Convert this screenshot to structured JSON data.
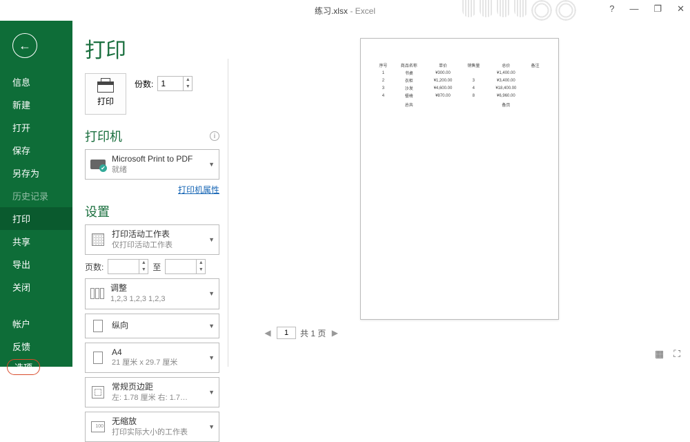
{
  "titlebar": {
    "filename": "练习.xlsx",
    "app": "Excel",
    "help": "?",
    "min": "—",
    "max": "❐",
    "close": "✕"
  },
  "sidebar": {
    "items": [
      {
        "label": "信息"
      },
      {
        "label": "新建"
      },
      {
        "label": "打开"
      },
      {
        "label": "保存"
      },
      {
        "label": "另存为"
      },
      {
        "label": "历史记录",
        "dim": true
      },
      {
        "label": "打印",
        "active": true
      },
      {
        "label": "共享"
      },
      {
        "label": "导出"
      },
      {
        "label": "关闭"
      }
    ],
    "bottom": [
      {
        "label": "帐户"
      },
      {
        "label": "反馈"
      }
    ],
    "highlight": "选项"
  },
  "panel": {
    "heading": "打印",
    "print_btn": "打印",
    "copies_label": "份数:",
    "copies_value": "1",
    "printer_head": "打印机",
    "printer": {
      "name": "Microsoft Print to PDF",
      "status": "就绪"
    },
    "printer_props": "打印机属性",
    "settings_head": "设置",
    "active_sheets": {
      "t": "打印活动工作表",
      "s": "仅打印活动工作表"
    },
    "pages_label": "页数:",
    "pages_to": "至",
    "collate": {
      "t": "调整",
      "s": "1,2,3   1,2,3   1,2,3"
    },
    "orient": {
      "t": "纵向"
    },
    "paper": {
      "t": "A4",
      "s": "21 厘米 x 29.7 厘米"
    },
    "margins": {
      "t": "常规页边距",
      "s": "左: 1.78 厘米  右: 1.7…"
    },
    "scale": {
      "t": "无缩放",
      "s": "打印实际大小的工作表",
      "num": "100"
    }
  },
  "preview": {
    "headers": [
      "序号",
      "商品名称",
      "单价",
      "销售量",
      "总价",
      "备注"
    ],
    "rows": [
      [
        "1",
        "书桌",
        "¥300.00",
        "",
        "¥1,400.00",
        ""
      ],
      [
        "2",
        "衣柜",
        "¥1,200.00",
        "3",
        "¥3,400.00",
        ""
      ],
      [
        "3",
        "沙发",
        "¥4,600.00",
        "4",
        "¥18,400.00",
        ""
      ],
      [
        "4",
        "餐椅",
        "¥870.00",
        "8",
        "¥6,960.00",
        ""
      ]
    ],
    "sum_l": "总共",
    "sum_r": "备页"
  },
  "pager": {
    "cur": "1",
    "total": "共 1 页"
  }
}
